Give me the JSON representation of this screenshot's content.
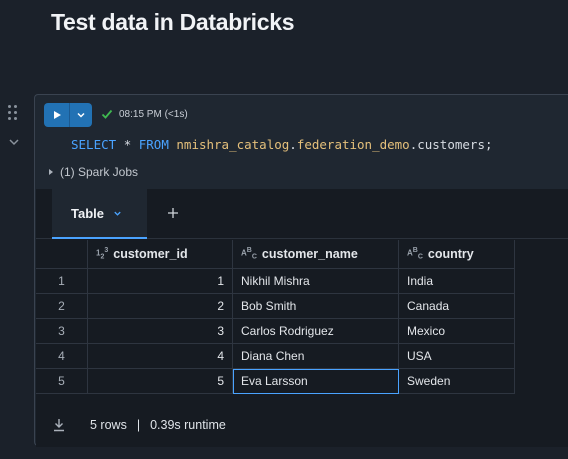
{
  "page": {
    "title": "Test data in Databricks"
  },
  "cell": {
    "status": {
      "timestamp": "08:15 PM (<1s)"
    },
    "code": {
      "select_kw": "SELECT",
      "star": "*",
      "from_kw": "FROM",
      "catalog": "nmishra_catalog",
      "schema": "federation_demo",
      "table": "customers",
      "terminator": ";"
    },
    "spark_jobs": "(1) Spark Jobs"
  },
  "results": {
    "tab_label": "Table",
    "columns": [
      {
        "name": "customer_id",
        "type_icon": "numeric-icon"
      },
      {
        "name": "customer_name",
        "type_icon": "string-icon"
      },
      {
        "name": "country",
        "type_icon": "string-icon"
      }
    ],
    "rows": [
      {
        "index": "1",
        "customer_id": "1",
        "customer_name": "Nikhil Mishra",
        "country": "India"
      },
      {
        "index": "2",
        "customer_id": "2",
        "customer_name": "Bob Smith",
        "country": "Canada"
      },
      {
        "index": "3",
        "customer_id": "3",
        "customer_name": "Carlos Rodriguez",
        "country": "Mexico"
      },
      {
        "index": "4",
        "customer_id": "4",
        "customer_name": "Diana Chen",
        "country": "USA"
      },
      {
        "index": "5",
        "customer_id": "5",
        "customer_name": "Eva Larsson",
        "country": "Sweden"
      }
    ],
    "footer": {
      "row_count": "5 rows",
      "separator": "|",
      "runtime": "0.39s runtime"
    }
  },
  "colors": {
    "accent": "#2272b4",
    "link": "#4aa3ff",
    "success": "#3fb950"
  }
}
